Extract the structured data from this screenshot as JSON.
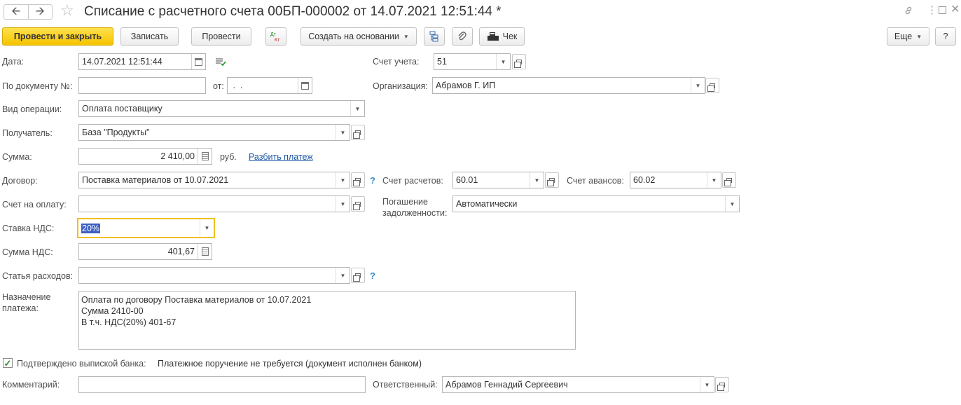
{
  "header": {
    "title": "Списание с расчетного счета 00БП-000002 от 14.07.2021 12:51:44 *",
    "back_icon": "arrow-left-icon",
    "forward_icon": "arrow-right-icon",
    "favorite_icon": "star-icon"
  },
  "window_icons": {
    "link": "link-icon",
    "menu": "more-vertical-icon",
    "maximize": "maximize-icon",
    "close": "close-icon"
  },
  "toolbar": {
    "post_close": "Провести и закрыть",
    "save": "Записать",
    "post": "Провести",
    "dt_kt": "Дт Кт",
    "create_based": "Создать на основании",
    "receipt": "Чек",
    "more": "Еще",
    "help": "?"
  },
  "form": {
    "date_label": "Дата:",
    "date_value": "14.07.2021 12:51:44",
    "doc_num_label": "По документу №:",
    "doc_num_value": "",
    "from_label": "от:",
    "from_value": " .  .",
    "account_label": "Счет учета:",
    "account_value": "51",
    "org_label": "Организация:",
    "org_value": "Абрамов Г. ИП",
    "op_type_label": "Вид операции:",
    "op_type_value": "Оплата поставщику",
    "recipient_label": "Получатель:",
    "recipient_value": "База \"Продукты\"",
    "sum_label": "Сумма:",
    "sum_value": "2 410,00",
    "currency": "руб.",
    "split_link": "Разбить платеж",
    "contract_label": "Договор:",
    "contract_value": "Поставка материалов от 10.07.2021",
    "settle_account_label": "Счет расчетов:",
    "settle_account_value": "60.01",
    "advance_account_label": "Счет авансов:",
    "advance_account_value": "60.02",
    "invoice_label": "Счет на оплату:",
    "invoice_value": "",
    "debt_label_1": "Погашение",
    "debt_label_2": "задолженности:",
    "debt_value": "Автоматически",
    "vat_rate_label": "Ставка НДС:",
    "vat_rate_value": "20%",
    "vat_sum_label": "Сумма НДС:",
    "vat_sum_value": "401,67",
    "expense_label": "Статья расходов:",
    "expense_value": "",
    "purpose_label_1": "Назначение",
    "purpose_label_2": "платежа:",
    "purpose_lines": [
      "Оплата по договору Поставка материалов от 10.07.2021",
      "Сумма 2410-00",
      "В т.ч. НДС(20%) 401-67"
    ],
    "confirmed_label": "Подтверждено выпиской банка:",
    "confirmed_checked": true,
    "confirmed_note": "Платежное поручение не требуется (документ исполнен банком)",
    "comment_label": "Комментарий:",
    "comment_value": "",
    "responsible_label": "Ответственный:",
    "responsible_value": "Абрамов Геннадий Сергеевич",
    "question": "?"
  },
  "colors": {
    "primary_button": "#f5c400",
    "link": "#1a58a8",
    "selection": "#3b5fc4",
    "focus_border": "#f0c020",
    "help_mark": "#3b8fc6"
  }
}
